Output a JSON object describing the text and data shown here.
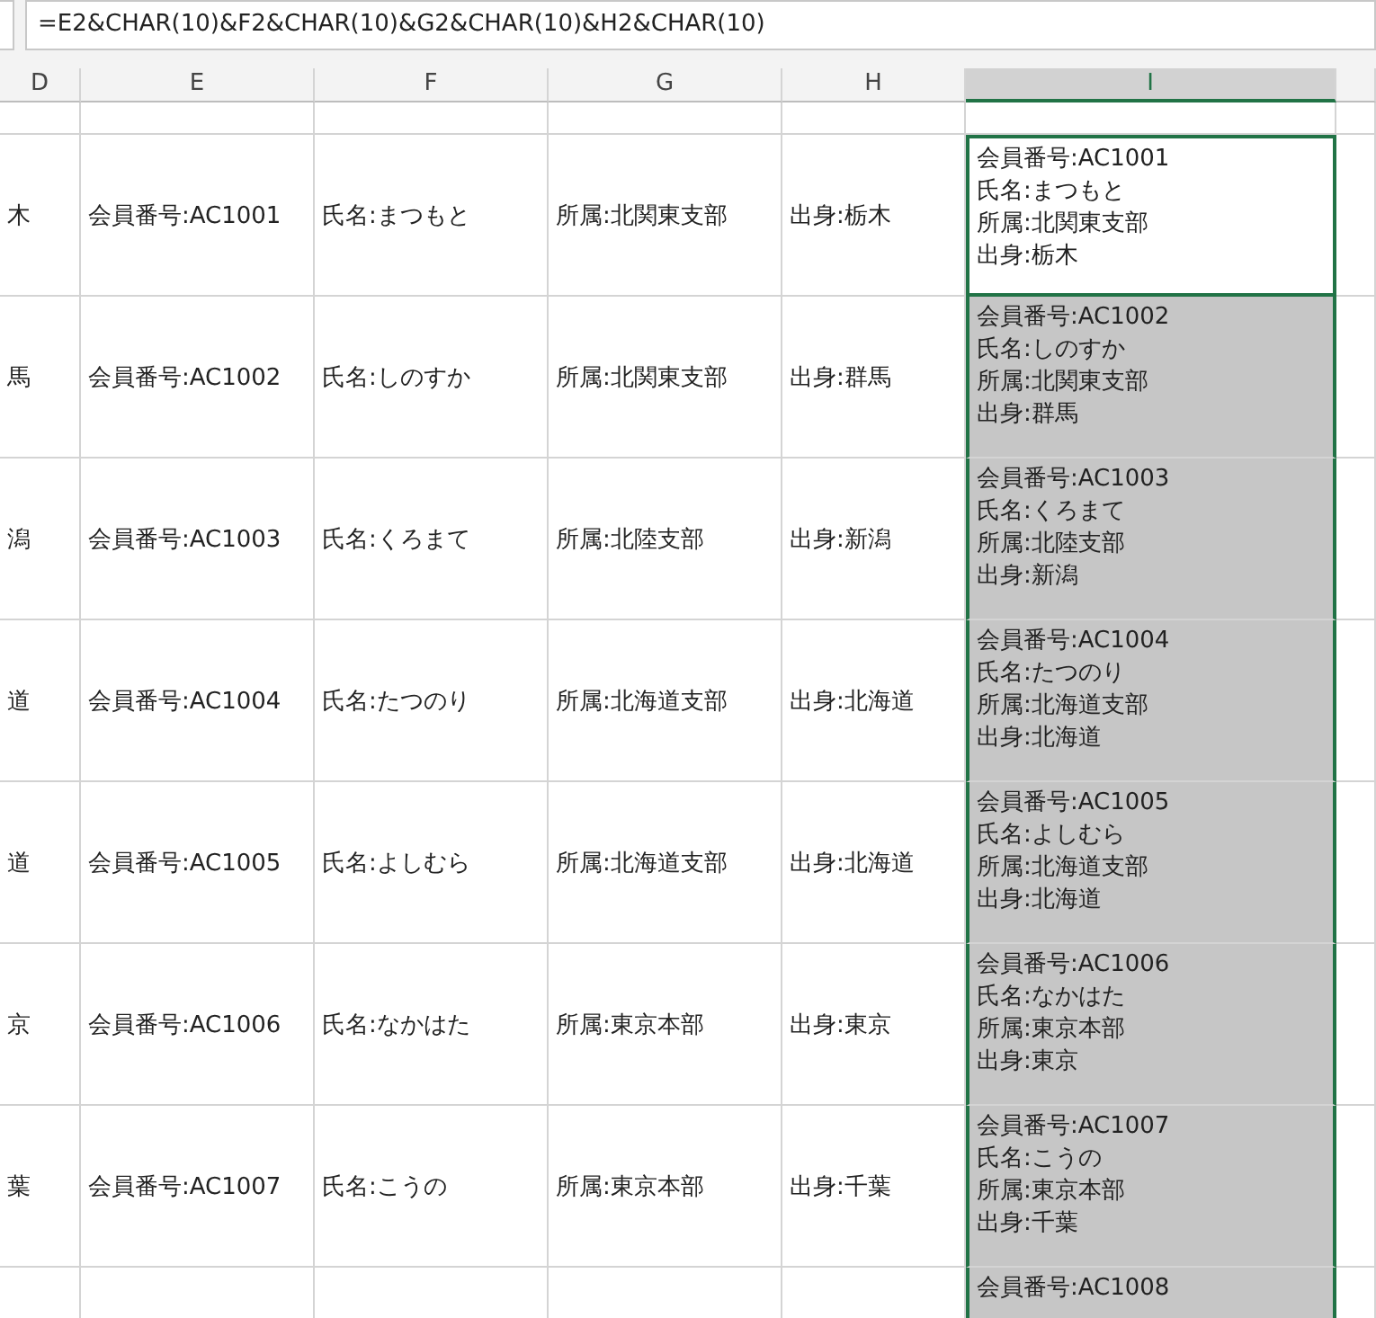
{
  "formula_bar": {
    "value": "=E2&CHAR(10)&F2&CHAR(10)&G2&CHAR(10)&H2&CHAR(10)"
  },
  "columns": [
    {
      "label": "D",
      "selected": false
    },
    {
      "label": "E",
      "selected": false
    },
    {
      "label": "F",
      "selected": false
    },
    {
      "label": "G",
      "selected": false
    },
    {
      "label": "H",
      "selected": false
    },
    {
      "label": "I",
      "selected": true
    }
  ],
  "rows": [
    {
      "column_d": "木",
      "member": "会員番号:AC1001",
      "name": "氏名:まつもと",
      "branch": "所属:北関東支部",
      "origin": "出身:栃木",
      "combined": [
        "会員番号:AC1001",
        "氏名:まつもと",
        "所属:北関東支部",
        "出身:栃木"
      ],
      "active": true,
      "selected": true
    },
    {
      "column_d": "馬",
      "member": "会員番号:AC1002",
      "name": "氏名:しのすか",
      "branch": "所属:北関東支部",
      "origin": "出身:群馬",
      "combined": [
        "会員番号:AC1002",
        "氏名:しのすか",
        "所属:北関東支部",
        "出身:群馬"
      ],
      "active": false,
      "selected": true
    },
    {
      "column_d": "潟",
      "member": "会員番号:AC1003",
      "name": "氏名:くろまて",
      "branch": "所属:北陸支部",
      "origin": "出身:新潟",
      "combined": [
        "会員番号:AC1003",
        "氏名:くろまて",
        "所属:北陸支部",
        "出身:新潟"
      ],
      "active": false,
      "selected": true
    },
    {
      "column_d": "道",
      "member": "会員番号:AC1004",
      "name": "氏名:たつのり",
      "branch": "所属:北海道支部",
      "origin": "出身:北海道",
      "combined": [
        "会員番号:AC1004",
        "氏名:たつのり",
        "所属:北海道支部",
        "出身:北海道"
      ],
      "active": false,
      "selected": true
    },
    {
      "column_d": "道",
      "member": "会員番号:AC1005",
      "name": "氏名:よしむら",
      "branch": "所属:北海道支部",
      "origin": "出身:北海道",
      "combined": [
        "会員番号:AC1005",
        "氏名:よしむら",
        "所属:北海道支部",
        "出身:北海道"
      ],
      "active": false,
      "selected": true
    },
    {
      "column_d": "京",
      "member": "会員番号:AC1006",
      "name": "氏名:なかはた",
      "branch": "所属:東京本部",
      "origin": "出身:東京",
      "combined": [
        "会員番号:AC1006",
        "氏名:なかはた",
        "所属:東京本部",
        "出身:東京"
      ],
      "active": false,
      "selected": true
    },
    {
      "column_d": "葉",
      "member": "会員番号:AC1007",
      "name": "氏名:こうの",
      "branch": "所属:東京本部",
      "origin": "出身:千葉",
      "combined": [
        "会員番号:AC1007",
        "氏名:こうの",
        "所属:東京本部",
        "出身:千葉"
      ],
      "active": false,
      "selected": true
    },
    {
      "combined": [
        "会員番号:AC1008"
      ],
      "active": false,
      "selected": true
    }
  ]
}
